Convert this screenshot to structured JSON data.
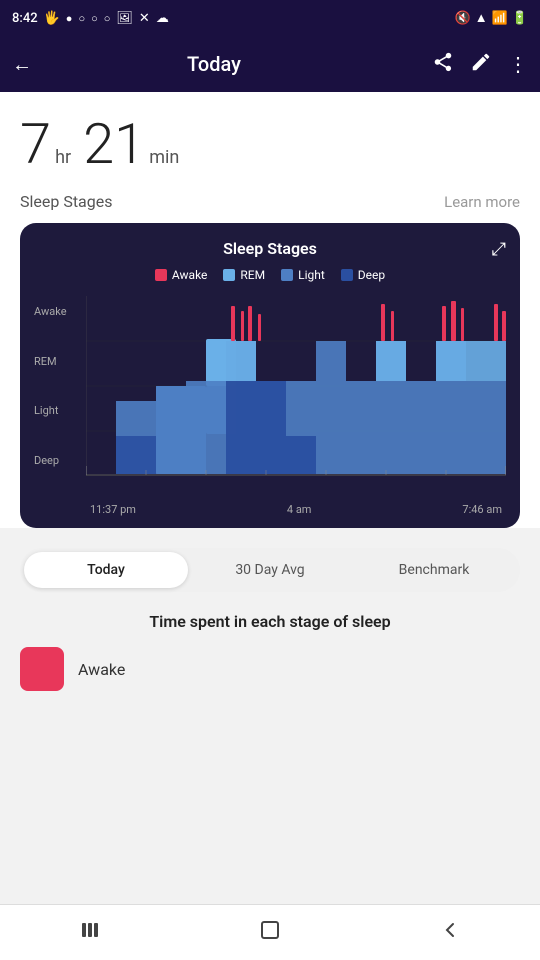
{
  "status_bar": {
    "time": "8:42",
    "left_icons": [
      "hand-icon",
      "notification-icon",
      "circle-icon",
      "circle-icon",
      "circle-icon",
      "image-icon",
      "x-icon",
      "cloud-icon"
    ],
    "right_icons": [
      "mute-icon",
      "wifi-icon",
      "signal-icon",
      "battery-icon"
    ]
  },
  "header": {
    "back_label": "←",
    "title": "Today",
    "share_label": "share",
    "edit_label": "edit",
    "more_label": "more"
  },
  "sleep_time": {
    "hours": "7",
    "hr_label": "hr",
    "minutes": "21",
    "min_label": "min"
  },
  "sleep_stages_section": {
    "title": "Sleep Stages",
    "learn_more": "Learn more"
  },
  "chart": {
    "title": "Sleep Stages",
    "legend": [
      {
        "id": "awake",
        "label": "Awake",
        "color": "#e8375a"
      },
      {
        "id": "rem",
        "label": "REM",
        "color": "#6ab0e8"
      },
      {
        "id": "light",
        "label": "Light",
        "color": "#4e7fc4"
      },
      {
        "id": "deep",
        "label": "Deep",
        "color": "#2a4fa0"
      }
    ],
    "y_labels": [
      "Awake",
      "REM",
      "Light",
      "Deep"
    ],
    "x_labels": [
      "11:37 pm",
      "4 am",
      "7:46 am"
    ]
  },
  "tabs": [
    {
      "id": "today",
      "label": "Today",
      "active": true
    },
    {
      "id": "30day",
      "label": "30 Day Avg",
      "active": false
    },
    {
      "id": "benchmark",
      "label": "Benchmark",
      "active": false
    }
  ],
  "time_spent": {
    "title": "Time spent in each stage of sleep",
    "stages": [
      {
        "id": "awake",
        "label": "Awake",
        "color": "#e8375a"
      }
    ]
  },
  "bottom_nav": {
    "icons": [
      "menu-icon",
      "home-icon",
      "back-icon"
    ]
  }
}
